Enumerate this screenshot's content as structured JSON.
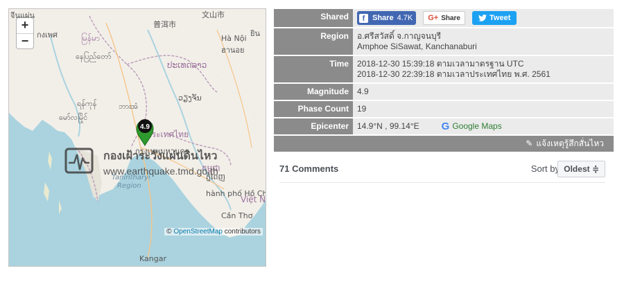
{
  "map": {
    "zoom_in": "+",
    "zoom_out": "−",
    "marker_value": "4.9",
    "labels": {
      "top_left_1": "จีนแผ่น",
      "top_left_2": "กงเพศ",
      "kunming": "文山市",
      "guangxi": "普洱市",
      "hanoi": "Hà Nội",
      "hanoi_th": "ฮานอย",
      "yin": "ยิน",
      "myanmar": "မြန်မာ",
      "naypyidaw": "နေပြည်တော်",
      "laos": "ປະເທດລາວ",
      "vientiane": "ວຽງຈັນ",
      "yangon": "ရန်ကုန်",
      "mawlamyine": "မော်လမြိုင်",
      "bangkok_small": "ဘားအံ",
      "thailand": "ประเทศไทย",
      "bangkok": "กรุงเทพมหานคร",
      "cambodia": "កម្ពុជា",
      "phnom_penh": "ភ្នំពេញ",
      "tanintharyi": "Tanintharyi",
      "region": "Region",
      "hcmc": "hành phố Hồ Chí Minh",
      "vietnam": "Việt N",
      "can_tho": "Cần Thơ",
      "kangar": "Kangar",
      "sothan": "ยิน"
    },
    "watermark_name": "กองเฝ้าระวังแผ่นดินไหว",
    "watermark_url": "www.earthquake.tmd.go.th",
    "attribution_symbol": "©",
    "attribution_osm": "OpenStreetMap",
    "attribution_rest": "contributors"
  },
  "info": {
    "shared_label": "Shared",
    "facebook_label": "Share",
    "facebook_count": "4.7K",
    "gplus_label": "Share",
    "twitter_label": "Tweet",
    "region_label": "Region",
    "region_line1": "อ.ศรีสวัสดิ์ จ.กาญจนบุรี",
    "region_line2": "Amphoe SiSawat, Kanchanaburi",
    "time_label": "Time",
    "time_line1": "2018-12-30 15:39:18 ตามเวลามาตรฐาน UTC",
    "time_line2": "2018-12-30 22:39:18 ตามเวลาประเทศไทย พ.ศ. 2561",
    "magnitude_label": "Magnitude",
    "magnitude_value": "4.9",
    "phase_label": "Phase Count",
    "phase_value": "19",
    "epicenter_label": "Epicenter",
    "epicenter_value": "14.9°N , 99.14°E",
    "google_maps_label": "Google Maps",
    "report_label": "แจ้งเหตุรู้สึกสั่นไหว"
  },
  "comments": {
    "count_label": "71 Comments",
    "sort_label": "Sort by",
    "sort_value": "Oldest ≑"
  },
  "colors": {
    "header_bg": "#8b8b8b",
    "value_bg": "#ebebeb",
    "facebook": "#4267b2",
    "twitter": "#1da1f2",
    "marker_green": "#2e9a2e"
  }
}
